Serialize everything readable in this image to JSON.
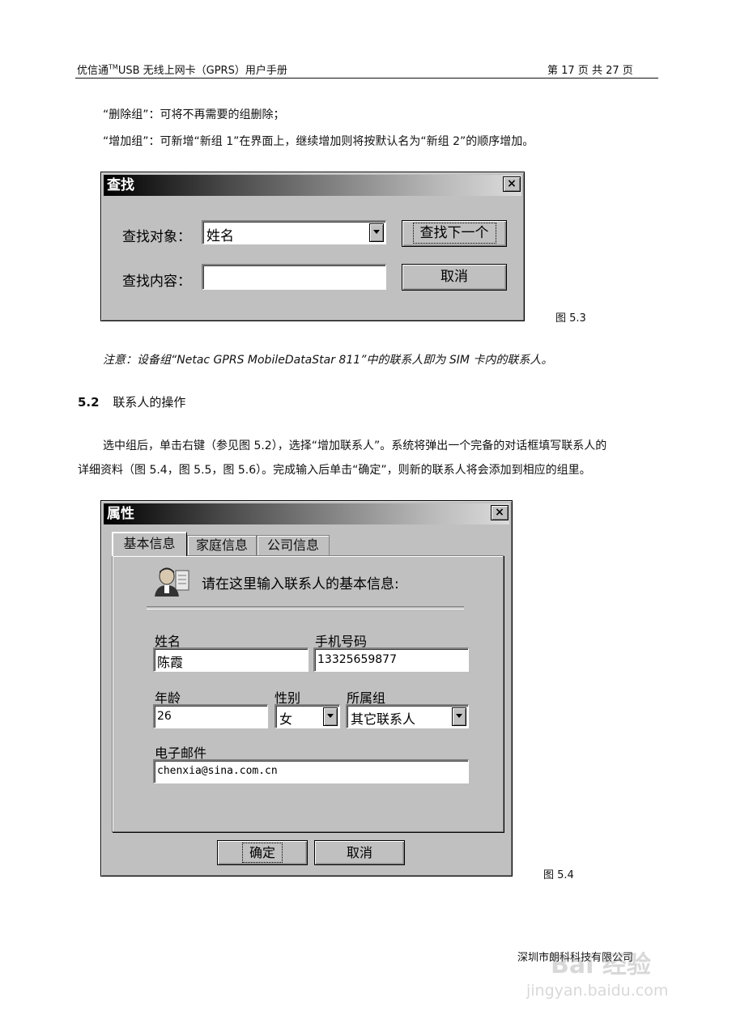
{
  "header": {
    "left": "优信通",
    "tm": "TM",
    "left_rest": "USB 无线上网卡（GPRS）用户手册",
    "right": "第 17 页 共 27 页"
  },
  "paras": {
    "delete_group": "“删除组”：可将不再需要的组删除；",
    "add_group": "“增加组”：可新增“新组 1”在界面上，继续增加则将按默认名为“新组 2”的顺序增加。"
  },
  "find_dialog": {
    "title": "查找",
    "close": "×",
    "target_label": "查找对象：",
    "target_value": "姓名",
    "content_label": "查找内容：",
    "content_value": "",
    "find_next_button": "查找下一个",
    "cancel_button": "取消"
  },
  "figure_53": "图 5.3",
  "note": "注意：设备组“Netac GPRS MobileDataStar 811”中的联系人即为 SIM 卡内的联系人。",
  "section": {
    "number": "5.2",
    "title": "联系人的操作"
  },
  "body_paras": {
    "line1": "选中组后，单击右键（参见图 5.2），选择“增加联系人”。系统将弹出一个完备的对话框填写联系人的",
    "line2": "详细资料（图 5.4，图 5.5，图 5.6）。完成输入后单击“确定”，则新的联系人将会添加到相应的组里。"
  },
  "props_dialog": {
    "title": "属性",
    "close": "×",
    "tabs": [
      "基本信息",
      "家庭信息",
      "公司信息"
    ],
    "intro": "请在这里输入联系人的基本信息:",
    "name_label": "姓名",
    "name_value": "陈霞",
    "phone_label": "手机号码",
    "phone_value": "13325659877",
    "age_label": "年龄",
    "age_value": "26",
    "gender_label": "性别",
    "gender_value": "女",
    "group_label": "所属组",
    "group_value": "其它联系人",
    "email_label": "电子邮件",
    "email_value": "chenxia@sina.com.cn",
    "ok_button": "确定",
    "cancel_button": "取消"
  },
  "figure_54": "图 5.4",
  "footer": {
    "company": "深圳市朗科科技有限公司",
    "watermark": "Bai 经验",
    "watermark_url": "jingyan.baidu.com"
  }
}
